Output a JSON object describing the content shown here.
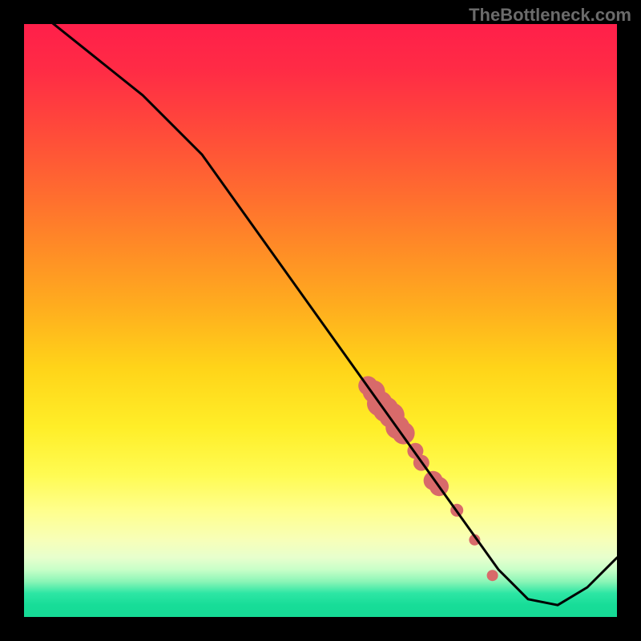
{
  "watermark": "TheBottleneck.com",
  "chart_data": {
    "type": "line",
    "title": "",
    "xlabel": "",
    "ylabel": "",
    "xlim": [
      0,
      100
    ],
    "ylim": [
      0,
      100
    ],
    "x": [
      0,
      10,
      20,
      30,
      40,
      50,
      60,
      70,
      75,
      80,
      85,
      90,
      95,
      100
    ],
    "values": [
      104,
      96,
      88,
      78,
      64,
      50,
      36,
      22,
      15,
      8,
      3,
      2,
      5,
      10
    ],
    "scatter": {
      "x": [
        58,
        59,
        60,
        61,
        62,
        63,
        64,
        66,
        67,
        69,
        70,
        73,
        76,
        79
      ],
      "y": [
        39,
        38,
        36,
        35,
        34,
        32,
        31,
        28,
        26,
        23,
        22,
        18,
        13,
        7
      ],
      "size": [
        12,
        14,
        16,
        16,
        16,
        15,
        14,
        10,
        10,
        12,
        12,
        8,
        7,
        7
      ]
    },
    "colors": {
      "line": "#000000",
      "scatter": "#d86a6a"
    }
  }
}
